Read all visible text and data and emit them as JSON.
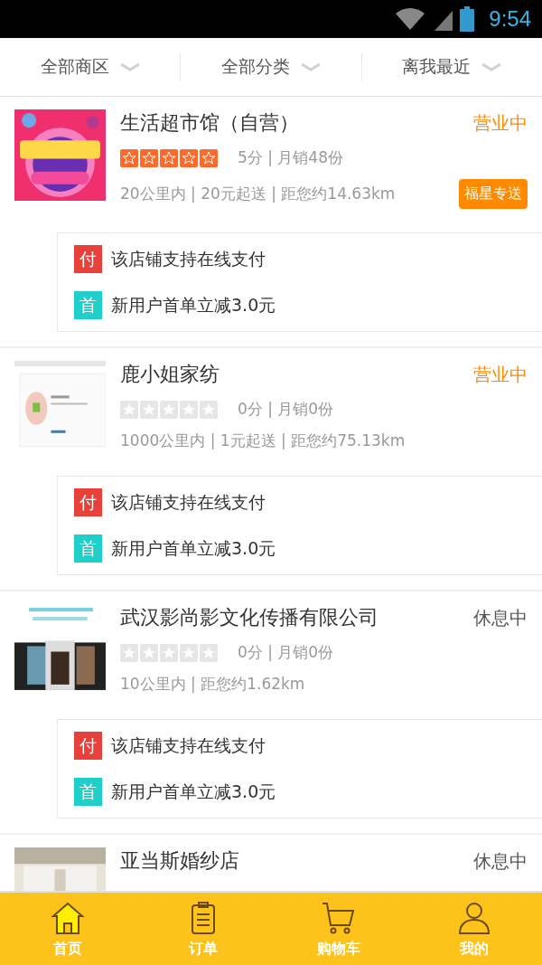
{
  "status_bar": {
    "time": "9:54"
  },
  "filters": [
    {
      "label": "全部商区"
    },
    {
      "label": "全部分类"
    },
    {
      "label": "离我最近"
    }
  ],
  "stores": [
    {
      "name": "生活超市馆（自营）",
      "status": "营业中",
      "open": true,
      "stars": 5,
      "rating": "5分 | 月销48份",
      "meta": "20公里内 | 20元起送 | 距您约14.63km",
      "badge": "福星专送",
      "thumb": {
        "kind": "picture"
      },
      "promos": [
        {
          "kind": "pay",
          "icon": "付",
          "text": "该店铺支持在线支付"
        },
        {
          "kind": "first",
          "icon": "首",
          "text": "新用户首单立减3.0元"
        }
      ]
    },
    {
      "name": "鹿小姐家纺",
      "status": "营业中",
      "open": true,
      "stars": 0,
      "rating": "0分 | 月销0份",
      "meta": "1000公里内 | 1元起送 | 距您约75.13km",
      "thumb": {
        "kind": "picture"
      },
      "promos": [
        {
          "kind": "pay",
          "icon": "付",
          "text": "该店铺支持在线支付"
        },
        {
          "kind": "first",
          "icon": "首",
          "text": "新用户首单立减3.0元"
        }
      ]
    },
    {
      "name": "武汉影尚影文化传播有限公司",
      "status": "休息中",
      "open": false,
      "stars": 0,
      "rating": "0分 | 月销0份",
      "meta": "10公里内 | 距您约1.62km",
      "thumb": {
        "kind": "picture"
      },
      "promos": [
        {
          "kind": "pay",
          "icon": "付",
          "text": "该店铺支持在线支付"
        },
        {
          "kind": "first",
          "icon": "首",
          "text": "新用户首单立减3.0元"
        }
      ]
    },
    {
      "name": "亚当斯婚纱店",
      "status": "休息中",
      "open": false,
      "thumb": {
        "kind": "picture"
      }
    }
  ],
  "tabs": [
    {
      "label": "首页",
      "selected": true
    },
    {
      "label": "订单",
      "selected": false
    },
    {
      "label": "购物车",
      "selected": false
    },
    {
      "label": "我的",
      "selected": false
    }
  ]
}
